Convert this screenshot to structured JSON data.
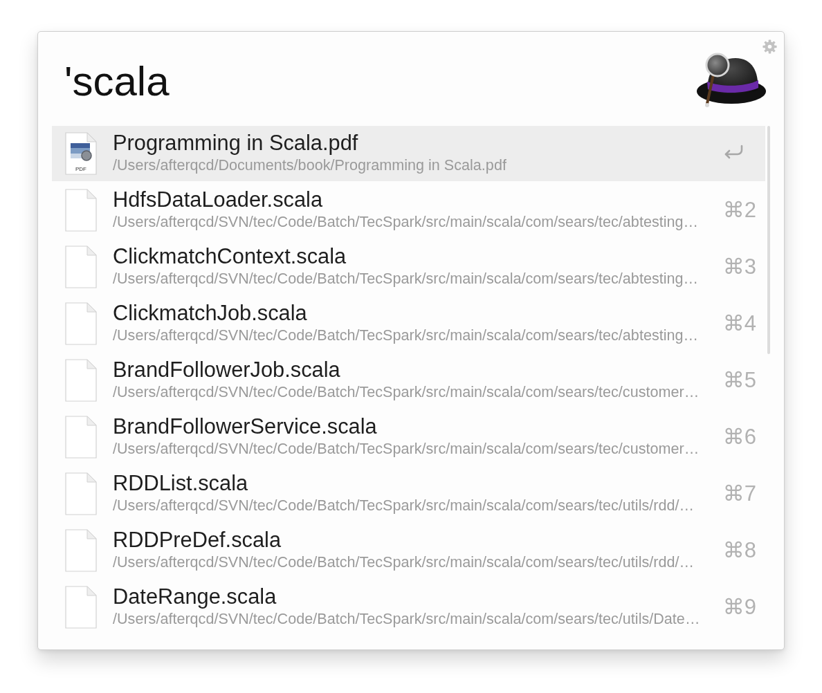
{
  "search": {
    "value": "'scala"
  },
  "results": [
    {
      "kind": "pdf",
      "file_type": "PDF",
      "title": "Programming in Scala.pdf",
      "path": "/Users/afterqcd/Documents/book/Programming in Scala.pdf",
      "selected": true
    },
    {
      "kind": "document",
      "title": "HdfsDataLoader.scala",
      "path": "/Users/afterqcd/SVN/tec/Code/Batch/TecSpark/src/main/scala/com/sears/tec/abtesting…",
      "shortcut": "⌘2",
      "selected": false
    },
    {
      "kind": "document",
      "title": "ClickmatchContext.scala",
      "path": "/Users/afterqcd/SVN/tec/Code/Batch/TecSpark/src/main/scala/com/sears/tec/abtesting…",
      "shortcut": "⌘3",
      "selected": false
    },
    {
      "kind": "document",
      "title": "ClickmatchJob.scala",
      "path": "/Users/afterqcd/SVN/tec/Code/Batch/TecSpark/src/main/scala/com/sears/tec/abtesting…",
      "shortcut": "⌘4",
      "selected": false
    },
    {
      "kind": "document",
      "title": "BrandFollowerJob.scala",
      "path": "/Users/afterqcd/SVN/tec/Code/Batch/TecSpark/src/main/scala/com/sears/tec/customer…",
      "shortcut": "⌘5",
      "selected": false
    },
    {
      "kind": "document",
      "title": "BrandFollowerService.scala",
      "path": "/Users/afterqcd/SVN/tec/Code/Batch/TecSpark/src/main/scala/com/sears/tec/customer…",
      "shortcut": "⌘6",
      "selected": false
    },
    {
      "kind": "document",
      "title": "RDDList.scala",
      "path": "/Users/afterqcd/SVN/tec/Code/Batch/TecSpark/src/main/scala/com/sears/tec/utils/rdd/…",
      "shortcut": "⌘7",
      "selected": false
    },
    {
      "kind": "document",
      "title": "RDDPreDef.scala",
      "path": "/Users/afterqcd/SVN/tec/Code/Batch/TecSpark/src/main/scala/com/sears/tec/utils/rdd/…",
      "shortcut": "⌘8",
      "selected": false
    },
    {
      "kind": "document",
      "title": "DateRange.scala",
      "path": "/Users/afterqcd/SVN/tec/Code/Batch/TecSpark/src/main/scala/com/sears/tec/utils/Date…",
      "shortcut": "⌘9",
      "selected": false
    }
  ]
}
